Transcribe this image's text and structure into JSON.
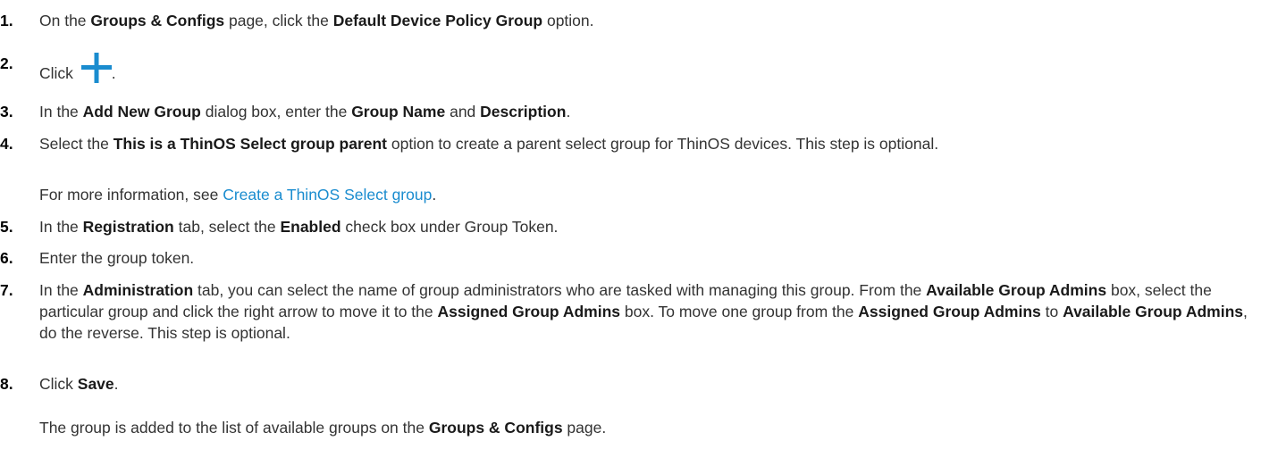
{
  "steps": [
    {
      "num": "1.",
      "parts": [
        "On the ",
        "Groups & Configs",
        " page, click the ",
        "Default Device Policy Group",
        " option."
      ]
    },
    {
      "num": "2.",
      "parts": [
        "Click ",
        "."
      ],
      "icon": "plus-icon",
      "icon_color": "#1a8ccf"
    },
    {
      "num": "3.",
      "parts": [
        "In the ",
        "Add New Group",
        " dialog box, enter the ",
        "Group Name",
        " and ",
        "Description",
        "."
      ]
    },
    {
      "num": "4.",
      "parts": [
        "Select the ",
        "This is a ThinOS Select group parent",
        " option to create a parent select group for ThinOS devices. This step is optional."
      ],
      "note": {
        "prefix": "For more information, see ",
        "link": "Create a ThinOS Select group",
        "suffix": "."
      }
    },
    {
      "num": "5.",
      "parts": [
        "In the ",
        "Registration",
        " tab, select the ",
        "Enabled",
        " check box under Group Token."
      ]
    },
    {
      "num": "6.",
      "parts": [
        "Enter the group token."
      ]
    },
    {
      "num": "7.",
      "parts": [
        "In the ",
        "Administration",
        " tab, you can select the name of group administrators who are tasked with managing this group. From the ",
        "Available Group Admins",
        " box, select the particular group and click the right arrow to move it to the ",
        "Assigned Group Admins",
        " box. To move one group from the ",
        "Assigned Group Admins",
        " to ",
        "Available Group Admins",
        ", do the reverse. This step is optional."
      ]
    },
    {
      "num": "8.",
      "parts": [
        "Click ",
        "Save",
        "."
      ],
      "note": {
        "prefix": "The group is added to the list of available groups on the ",
        "bold": "Groups & Configs",
        "suffix": " page."
      }
    }
  ],
  "colors": {
    "text": "#333333",
    "link": "#1a8ccf",
    "number": "#000000"
  }
}
